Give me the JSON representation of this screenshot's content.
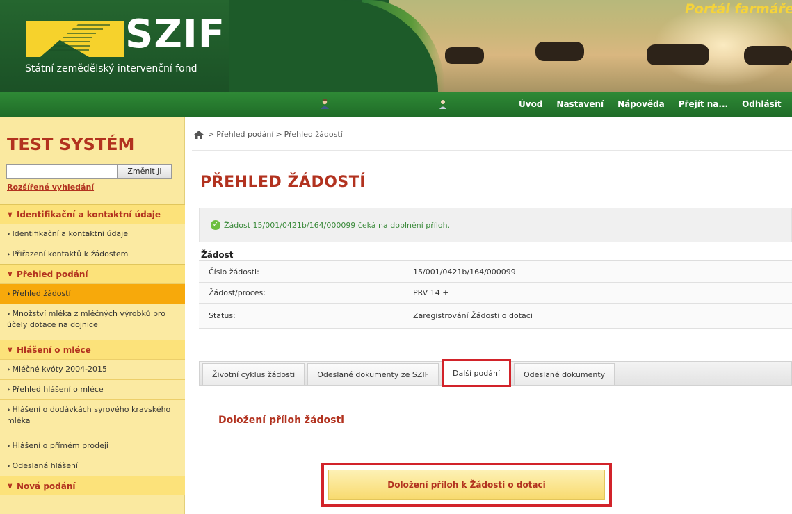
{
  "header": {
    "logo_text": "SZIF",
    "logo_subtitle": "Státní zemědělský intervenční fond",
    "portal_title": "Portál farmáře"
  },
  "topnav": {
    "links": [
      "Úvod",
      "Nastavení",
      "Nápověda",
      "Přejít na...",
      "Odhlásit"
    ]
  },
  "sidebar": {
    "system_title": "TEST SYSTÉM",
    "search_value": "",
    "search_button": "Změnit JI",
    "advanced_search": "Rozšířené vyhledání",
    "sections": [
      {
        "label": "Identifikační a kontaktní údaje",
        "items": [
          "Identifikační a kontaktní údaje",
          "Přiřazení kontaktů k žádostem"
        ]
      },
      {
        "label": "Přehled podání",
        "items": [
          "Přehled žádostí",
          "Množství mléka z mléčných výrobků pro účely dotace na dojnice"
        ]
      },
      {
        "label": "Hlášení o mléce",
        "items": [
          "Mléčné kvóty 2004-2015",
          "Přehled hlášení o mléce",
          "Hlášení o dodávkách syrového kravského mléka",
          "Hlášení o přímém prodeji",
          "Odeslaná hlášení"
        ]
      },
      {
        "label": "Nová podání",
        "items": []
      }
    ]
  },
  "breadcrumb": {
    "sep": ">",
    "link": "Přehled podání",
    "current": "Přehled žádostí"
  },
  "main": {
    "page_title": "PŘEHLED ŽÁDOSTÍ",
    "alert": "Žádost 15/001/0421b/164/000099 čeká na doplnění příloh.",
    "detail": {
      "heading": "Žádost",
      "rows": [
        {
          "key": "Číslo žádosti:",
          "value": "15/001/0421b/164/000099"
        },
        {
          "key": "Žádost/proces:",
          "value": "PRV 14 +"
        },
        {
          "key": "Status:",
          "value": "Zaregistrování Žádosti o dotaci"
        }
      ]
    },
    "tabs": [
      "Životní cyklus žádosti",
      "Odeslané dokumenty ze SZIF",
      "Další podání",
      "Odeslané dokumenty"
    ],
    "section_title": "Doložení příloh žádosti",
    "attach_button": "Doložení příloh k Žádosti o dotaci"
  },
  "colors": {
    "accent_red": "#b2321f",
    "highlight_red": "#d2232a",
    "header_green": "#1e5a2b",
    "nav_green": "#2f8a36",
    "sidebar_yellow": "#fae9a0",
    "active_orange": "#f7a90b"
  },
  "icons": [
    "home-icon",
    "user-icon",
    "person-icon",
    "check-circle-icon",
    "chevron-down-icon",
    "chevron-right-icon"
  ]
}
